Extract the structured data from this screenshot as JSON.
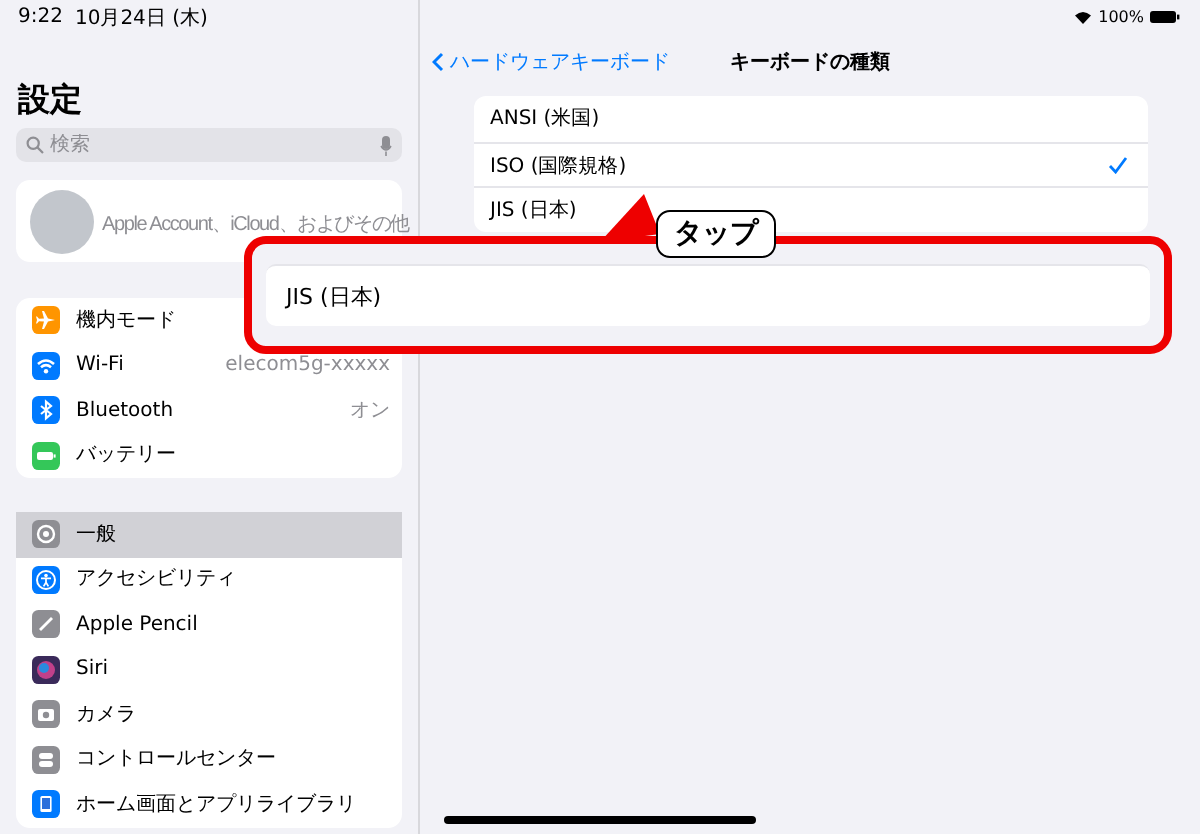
{
  "status_bar": {
    "time": "9:22",
    "date": "10月24日 (木)",
    "battery": "100%"
  },
  "sidebar": {
    "title": "設定",
    "search": {
      "placeholder": "検索"
    },
    "account": {
      "subtitle": "Apple Account、iCloud、およびその他"
    },
    "groups": [
      [
        {
          "label": "機内モード",
          "kind": "airplane",
          "color": "#ff9500",
          "selected": false
        },
        {
          "label": "Wi-Fi",
          "value": "elecom5g-xxxxx",
          "kind": "wifi",
          "color": "#007aff",
          "selected": false
        },
        {
          "label": "Bluetooth",
          "value": "オン",
          "kind": "bluetooth",
          "color": "#007aff",
          "selected": false
        },
        {
          "label": "バッテリー",
          "kind": "battery",
          "color": "#34c759",
          "selected": false
        }
      ],
      [
        {
          "label": "一般",
          "kind": "gear",
          "color": "#8e8e93",
          "selected": true
        },
        {
          "label": "アクセシビリティ",
          "kind": "person",
          "color": "#007aff",
          "selected": false
        },
        {
          "label": "Apple Pencil",
          "kind": "pencil",
          "color": "#8e8e93",
          "selected": false
        },
        {
          "label": "Siri",
          "kind": "orb",
          "color": "#3a2a5a",
          "selected": false
        },
        {
          "label": "カメラ",
          "kind": "camera",
          "color": "#8e8e93",
          "selected": false
        },
        {
          "label": "コントロールセンター",
          "kind": "toggles",
          "color": "#8e8e93",
          "selected": false
        },
        {
          "label": "ホーム画面とアプリライブラリ",
          "kind": "home",
          "color": "#007aff",
          "selected": false
        }
      ]
    ]
  },
  "detail": {
    "back": "ハードウェアキーボード",
    "title": "キーボードの種類",
    "options": [
      {
        "label": "ANSI (米国)",
        "selected": false
      },
      {
        "label": "ISO (国際規格)",
        "selected": true
      },
      {
        "label": "JIS (日本)",
        "selected": false
      }
    ]
  },
  "callout": {
    "label": "タップ"
  },
  "zoom_panel": {
    "label": "JIS (日本)"
  }
}
